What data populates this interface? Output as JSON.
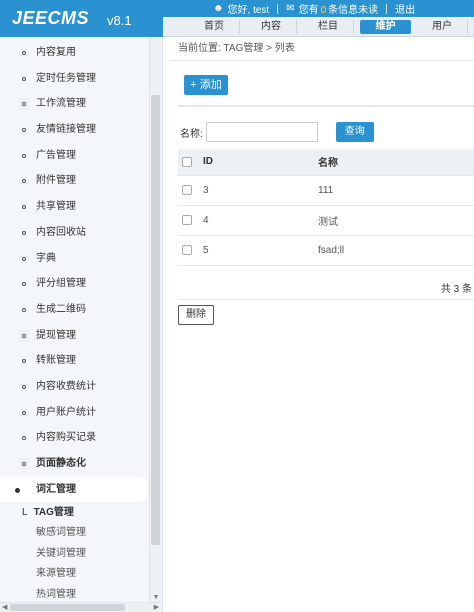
{
  "app": {
    "logo": "JEECMS",
    "version": "v8.1"
  },
  "topbar": {
    "greeting": "您好, test",
    "messages_prefix": "您有",
    "messages_count": "0",
    "messages_suffix": "条信息未读",
    "logout": "退出"
  },
  "nav": {
    "items": [
      "首页",
      "内容",
      "栏目",
      "维护",
      "用户"
    ],
    "active": "维护"
  },
  "sidebar": {
    "items": [
      "内容复用",
      "定时任务管理",
      "工作流管理",
      "友情链接管理",
      "广告管理",
      "附件管理",
      "共享管理",
      "内容回收站",
      "字典",
      "评分组管理",
      "生成二维码",
      "提现管理",
      "转账管理",
      "内容收费统计",
      "用户账户统计",
      "内容购买记录"
    ],
    "bold_item": "页面静态化",
    "active_item": "词汇管理",
    "sub_head_prefix": "L",
    "sub_head": "TAG管理",
    "sub_items": [
      "敏感词管理",
      "关键词管理",
      "来源管理",
      "热词管理"
    ]
  },
  "main": {
    "breadcrumb": "当前位置: TAG管理 > 列表",
    "add_label": "添加",
    "search_label": "名称:",
    "search_value": "",
    "search_button": "查询",
    "columns": {
      "id": "ID",
      "name": "名称"
    },
    "rows": [
      {
        "id": "3",
        "name": "111"
      },
      {
        "id": "4",
        "name": "测试"
      },
      {
        "id": "5",
        "name": "fsad;ll"
      }
    ],
    "total": "共 3 条",
    "delete_label": "删除"
  }
}
